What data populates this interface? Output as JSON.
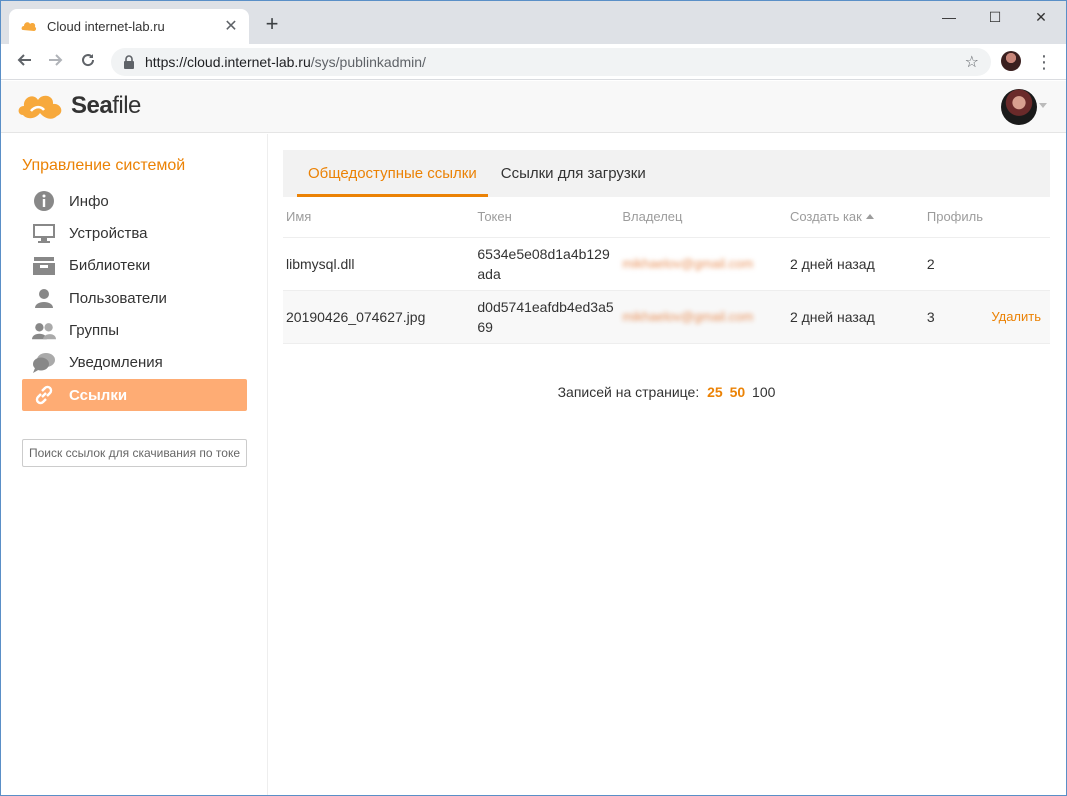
{
  "browser": {
    "tab_title": "Cloud internet-lab.ru",
    "tab_close": "✕",
    "new_tab": "+",
    "url_host": "https://cloud.internet-lab.ru",
    "url_path": "/sys/publinkadmin/",
    "win_minimize": "—",
    "win_maximize": "☐",
    "win_close": "✕"
  },
  "header": {
    "logo_bold": "Sea",
    "logo_rest": "file"
  },
  "sidebar": {
    "title": "Управление системой",
    "items": [
      {
        "label": "Инфо",
        "icon": "info-icon"
      },
      {
        "label": "Устройства",
        "icon": "monitor-icon"
      },
      {
        "label": "Библиотеки",
        "icon": "archive-icon"
      },
      {
        "label": "Пользователи",
        "icon": "user-icon"
      },
      {
        "label": "Группы",
        "icon": "group-icon"
      },
      {
        "label": "Уведомления",
        "icon": "chat-icon"
      },
      {
        "label": "Ссылки",
        "icon": "link-icon",
        "active": true
      }
    ],
    "search_placeholder": "Поиск ссылок для скачивания по токену"
  },
  "tabs": [
    {
      "label": "Общедоступные ссылки",
      "active": true
    },
    {
      "label": "Ссылки для загрузки",
      "active": false
    }
  ],
  "table": {
    "columns": [
      "Имя",
      "Токен",
      "Владелец",
      "Создать как",
      "Профиль"
    ],
    "rows": [
      {
        "name": "libmysql.dll",
        "token_1": "6534e5e08d1a4b129",
        "token_2": "ada",
        "owner": "mikhaelov@gmail.com",
        "created": "2 дней назад",
        "views": "2",
        "action": ""
      },
      {
        "name": "20190426_074627.jpg",
        "token_1": "d0d5741eafdb4ed3a5",
        "token_2": "69",
        "owner": "mikhaelov@gmail.com",
        "created": "2 дней назад",
        "views": "3",
        "action": "Удалить"
      }
    ]
  },
  "pager": {
    "label": "Записей на странице:",
    "options": [
      "25",
      "50",
      "100"
    ]
  },
  "colors": {
    "accent": "#eb8205",
    "active_bg": "#feac74"
  }
}
